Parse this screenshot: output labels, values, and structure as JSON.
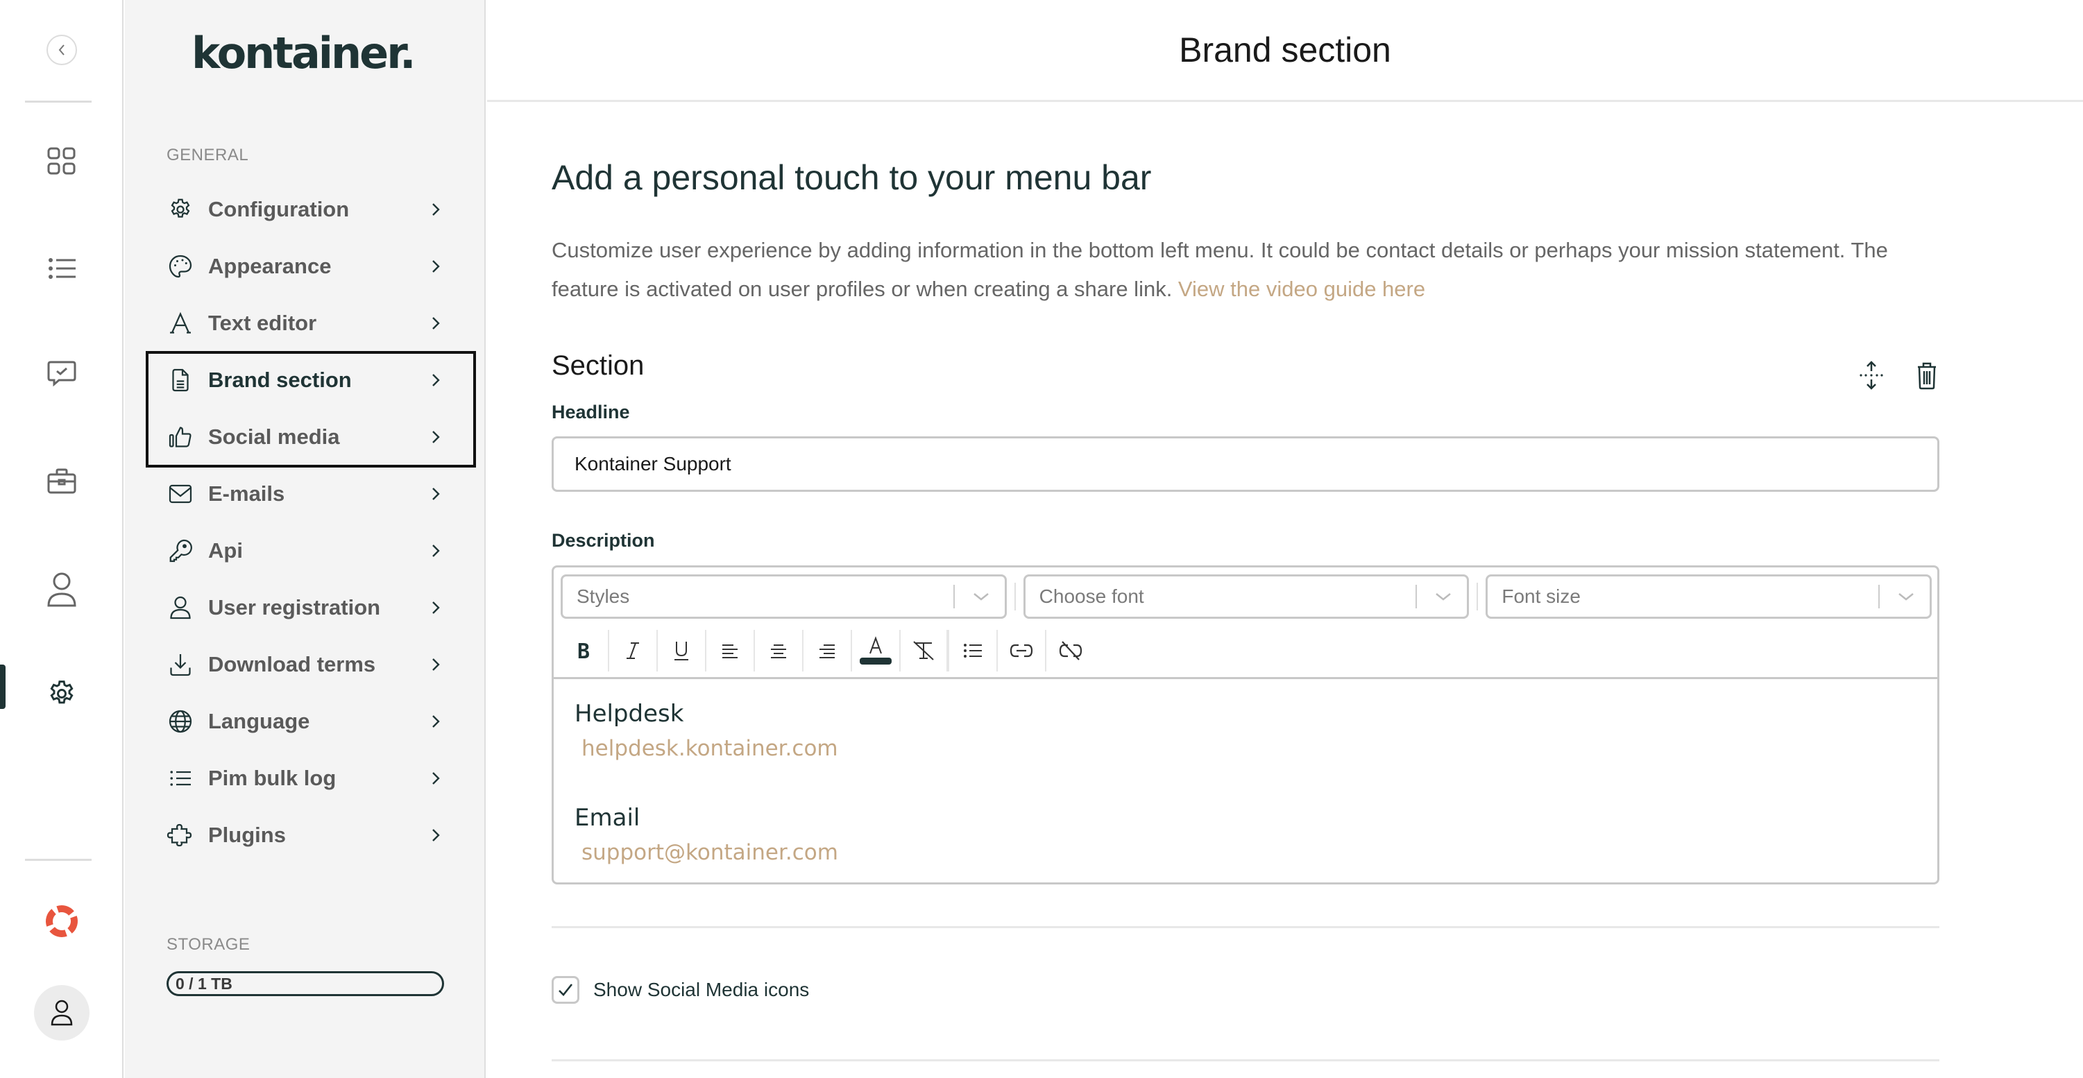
{
  "rail": {
    "icons": [
      {
        "name": "dashboard",
        "icon": "grid-icon"
      },
      {
        "name": "lists",
        "icon": "list-icon"
      },
      {
        "name": "approvals",
        "icon": "chat-check-icon"
      },
      {
        "name": "portfolio",
        "icon": "briefcase-icon"
      },
      {
        "name": "users",
        "icon": "user-icon"
      },
      {
        "name": "settings",
        "icon": "gear-icon",
        "active": true
      }
    ],
    "help_icon": "lifebuoy-icon",
    "avatar_icon": "user-icon"
  },
  "nav": {
    "logo": "kontainer.",
    "general_label": "GENERAL",
    "items": [
      {
        "label": "Configuration",
        "icon": "gear-icon"
      },
      {
        "label": "Appearance",
        "icon": "palette-icon"
      },
      {
        "label": "Text editor",
        "icon": "font-icon"
      },
      {
        "label": "Brand section",
        "icon": "document-icon",
        "active": true
      },
      {
        "label": "Social media",
        "icon": "thumbs-up-icon"
      },
      {
        "label": "E-mails",
        "icon": "envelope-icon"
      },
      {
        "label": "Api",
        "icon": "key-icon"
      },
      {
        "label": "User registration",
        "icon": "user-icon"
      },
      {
        "label": "Download terms",
        "icon": "download-icon"
      },
      {
        "label": "Language",
        "icon": "globe-icon"
      },
      {
        "label": "Pim bulk log",
        "icon": "list-icon"
      },
      {
        "label": "Plugins",
        "icon": "puzzle-icon"
      }
    ],
    "storage_label": "STORAGE",
    "storage_value": "0 / 1 TB",
    "storage_fraction": 0
  },
  "header": {
    "title": "Brand section"
  },
  "content": {
    "heading": "Add a personal touch to your menu bar",
    "intro_text": "Customize user experience by adding information in the bottom left menu. It could be contact details or perhaps your mission statement. The feature is activated on user profiles or when creating a share link. ",
    "guide_link": "View the video guide here",
    "section_title": "Section",
    "headline_label": "Headline",
    "headline_value": "Kontainer Support",
    "description_label": "Description",
    "editor": {
      "styles_placeholder": "Styles",
      "font_placeholder": "Choose font",
      "size_placeholder": "Font size",
      "toolbar": [
        "bold",
        "italic",
        "underline",
        "align-left",
        "align-center",
        "align-right",
        "text-color",
        "clear-format",
        "bullet-list",
        "link",
        "unlink"
      ],
      "lines": [
        {
          "type": "text",
          "value": "Helpdesk"
        },
        {
          "type": "link",
          "value": "helpdesk.kontainer.com"
        },
        {
          "type": "gap"
        },
        {
          "type": "text",
          "value": "Email"
        },
        {
          "type": "link",
          "value": "support@kontainer.com"
        }
      ]
    },
    "show_social_label": "Show Social Media icons",
    "show_social_checked": true
  },
  "colors": {
    "primary": "#1f3435",
    "link": "#c4a784",
    "help": "#e8553e",
    "sidebar_bg": "#f4f4f4"
  }
}
